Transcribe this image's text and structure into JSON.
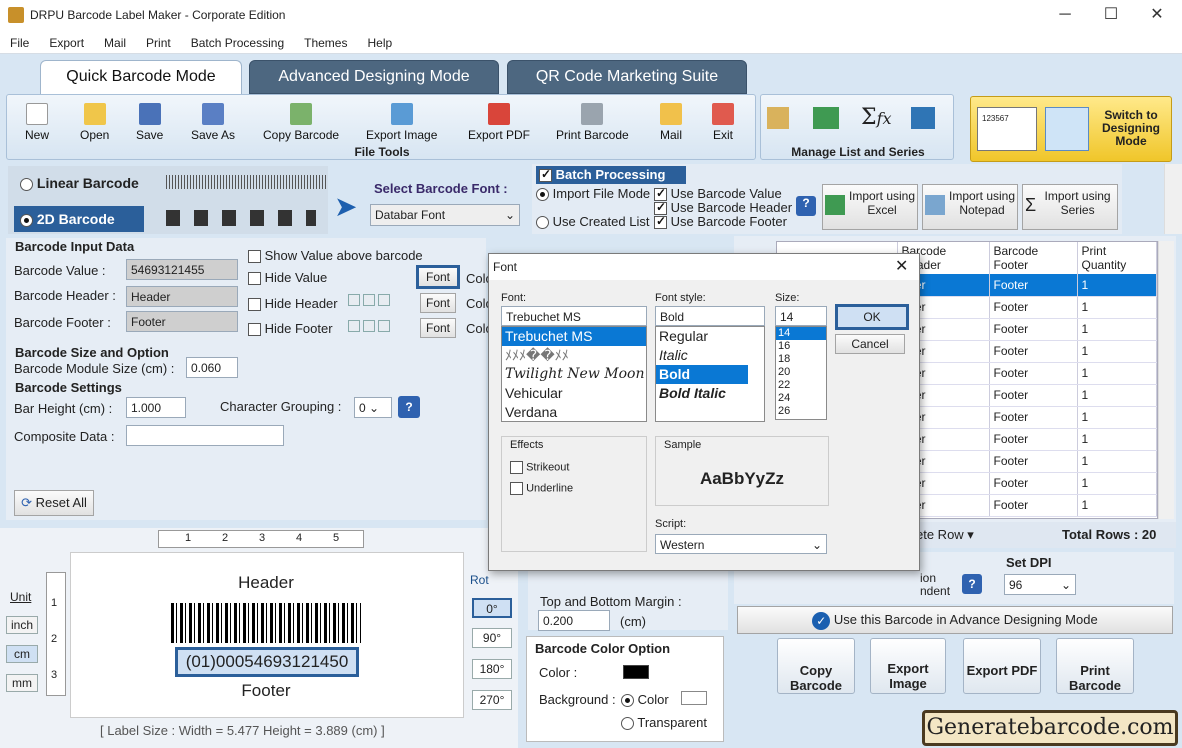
{
  "window": {
    "title": "DRPU Barcode Label Maker - Corporate Edition",
    "minimize": "─",
    "maximize": "☐",
    "close": "✕"
  },
  "menu": [
    "File",
    "Export",
    "Mail",
    "Print",
    "Batch Processing",
    "Themes",
    "Help"
  ],
  "tabs": [
    "Quick Barcode Mode",
    "Advanced Designing Mode",
    "QR Code Marketing Suite"
  ],
  "toolbar": {
    "items": [
      "New",
      "Open",
      "Save",
      "Save As",
      "Copy Barcode",
      "Export Image",
      "Export PDF",
      "Print Barcode",
      "Mail",
      "Exit"
    ],
    "group_label": "File Tools",
    "manage_label": "Manage List and Series",
    "switch_label": "Switch to Designing Mode",
    "switch_thumb_text": "123567"
  },
  "barcode_type": {
    "linear": "Linear Barcode",
    "two_d": "2D Barcode"
  },
  "select_font": {
    "label": "Select Barcode Font :",
    "value": "Databar Font"
  },
  "batch": {
    "title": "Batch Processing",
    "import_mode": "Import File Mode",
    "created_list": "Use Created List",
    "use_value": "Use Barcode Value",
    "use_header": "Use Barcode Header",
    "use_footer": "Use Barcode Footer",
    "import_excel": "Import using Excel",
    "import_notepad": "Import using Notepad",
    "import_series": "Import using Series"
  },
  "input_data": {
    "title": "Barcode Input Data",
    "value_label": "Barcode Value :",
    "value": "54693121455",
    "header_label": "Barcode Header :",
    "header": "Header",
    "footer_label": "Barcode Footer :",
    "footer": "Footer",
    "show_above": "Show Value above barcode",
    "hide_value": "Hide Value",
    "hide_header": "Hide Header",
    "hide_footer": "Hide Footer",
    "font_btn": "Font",
    "color_short": "Colo"
  },
  "size_option": {
    "title": "Barcode Size and Option",
    "module_label": "Barcode Module Size (cm) :",
    "module_value": "0.060"
  },
  "settings": {
    "title": "Barcode Settings",
    "bar_height_label": "Bar Height (cm) :",
    "bar_height": "1.000",
    "char_group_label": "Character Grouping :",
    "char_group": "0",
    "composite_label": "Composite Data :",
    "reset": "Reset All"
  },
  "grid": {
    "headers": [
      "Barcode Header",
      "Barcode Footer",
      "Print Quantity"
    ],
    "rows": [
      [
        "ader",
        "Footer",
        "1"
      ],
      [
        "ader",
        "Footer",
        "1"
      ],
      [
        "ader",
        "Footer",
        "1"
      ],
      [
        "ader",
        "Footer",
        "1"
      ],
      [
        "ader",
        "Footer",
        "1"
      ],
      [
        "ader",
        "Footer",
        "1"
      ],
      [
        "ader",
        "Footer",
        "1"
      ],
      [
        "ader",
        "Footer",
        "1"
      ],
      [
        "ader",
        "Footer",
        "1"
      ],
      [
        "ader",
        "Footer",
        "1"
      ],
      [
        "ader",
        "Footer",
        "1"
      ]
    ],
    "selected_row": 0,
    "delete_row": "ete Row ▾",
    "total_rows": "Total Rows : 20"
  },
  "preview": {
    "unit": "Unit",
    "units": [
      "inch",
      "cm",
      "mm"
    ],
    "ruler_top": [
      "1",
      "2",
      "3",
      "4",
      "5"
    ],
    "ruler_left": [
      "1",
      "2",
      "3"
    ],
    "header": "Header",
    "barcode_text": "(01)00054693121450",
    "footer": "Footer",
    "label_size": "[ Label Size : Width = 5.477  Height = 3.889 (cm) ]",
    "rot_label": "Rot",
    "rotations": [
      "0°",
      "90°",
      "180°",
      "270°"
    ]
  },
  "margins": {
    "top_bottom_label": "Top and Bottom Margin :",
    "value": "0.200",
    "unit": "(cm)"
  },
  "color_option": {
    "title": "Barcode Color Option",
    "color_label": "Color :",
    "background_label": "Background :",
    "color_radio": "Color",
    "transparent": "Transparent"
  },
  "dpi": {
    "title": "Set DPI",
    "value": "96",
    "partial1": "ion",
    "partial2": "ndent"
  },
  "advance_mode": "Use this Barcode in Advance Designing Mode",
  "actions": [
    "Copy Barcode",
    "Export Image",
    "Export PDF",
    "Print Barcode"
  ],
  "watermark": "Generatebarcode.com",
  "font_dialog": {
    "title": "Font",
    "font_label": "Font:",
    "font_value": "Trebuchet MS",
    "fonts": [
      "Trebuchet MS",
      "ﾒﾒﾒ��ﾒﾒ",
      "Twilight New Moon",
      "Vehicular",
      "Verdana"
    ],
    "style_label": "Font style:",
    "style_value": "Bold",
    "styles": [
      "Regular",
      "Italic",
      "Bold",
      "Bold Italic"
    ],
    "size_label": "Size:",
    "size_value": "14",
    "sizes": [
      "14",
      "16",
      "18",
      "20",
      "22",
      "24",
      "26"
    ],
    "ok": "OK",
    "cancel": "Cancel",
    "effects_label": "Effects",
    "strikeout": "Strikeout",
    "underline": "Underline",
    "sample_label": "Sample",
    "sample": "AaBbYyZz",
    "script_label": "Script:",
    "script_value": "Western"
  }
}
